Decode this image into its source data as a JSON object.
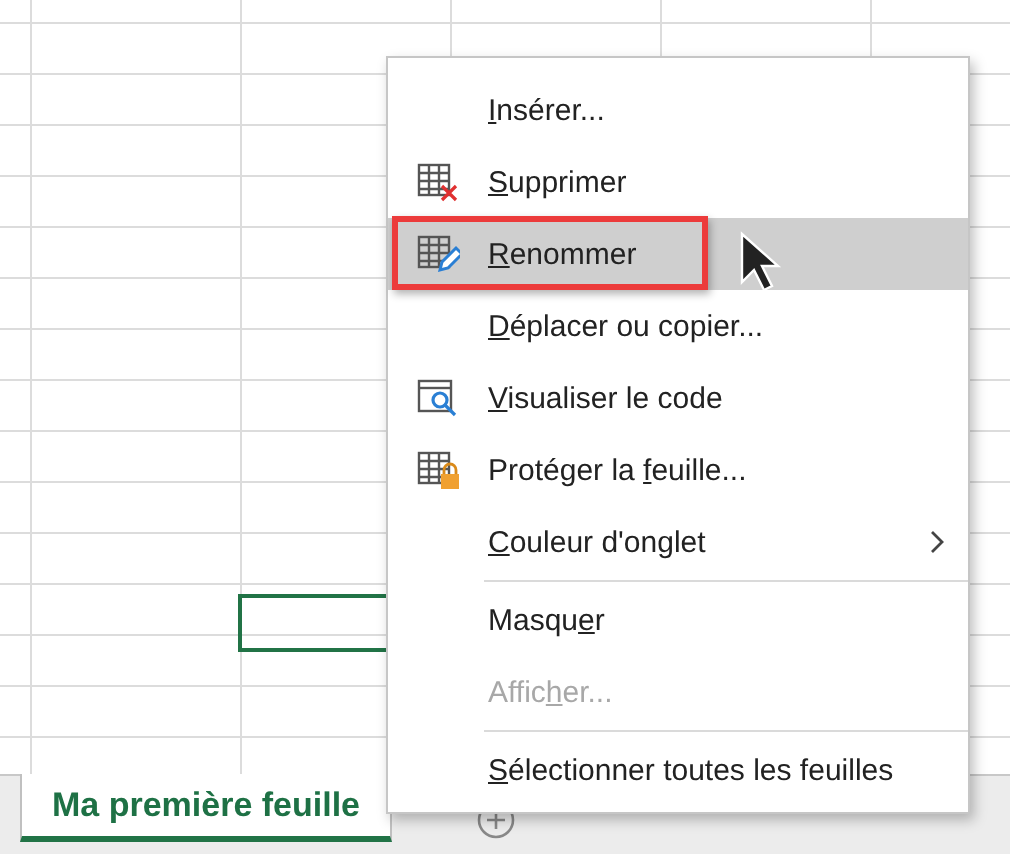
{
  "context_menu": {
    "items": [
      {
        "kind": "plain",
        "key": "I",
        "after": "nsérer...",
        "disabled": false,
        "selected": false,
        "annotated": false
      },
      {
        "kind": "delete",
        "key": "S",
        "after": "upprimer",
        "disabled": false,
        "selected": false,
        "annotated": false
      },
      {
        "kind": "rename",
        "key": "R",
        "after": "enommer",
        "disabled": false,
        "selected": true,
        "annotated": true
      },
      {
        "kind": "plain",
        "key": "D",
        "after": "éplacer ou copier...",
        "disabled": false,
        "selected": false,
        "annotated": false
      },
      {
        "kind": "view",
        "key": "V",
        "after": "isualiser le code",
        "disabled": false,
        "selected": false,
        "annotated": false
      },
      {
        "kind": "protect",
        "before": "Protéger la ",
        "key": "f",
        "after": "euille...",
        "disabled": false,
        "selected": false,
        "annotated": false
      },
      {
        "kind": "submenu",
        "key": "C",
        "after": "ouleur d'onglet",
        "disabled": false,
        "selected": false,
        "annotated": false
      },
      {
        "kind": "separator"
      },
      {
        "kind": "plain",
        "before": "Masqu",
        "key": "e",
        "after": "r",
        "disabled": false,
        "selected": false,
        "annotated": false
      },
      {
        "kind": "plain",
        "before": "Affic",
        "key": "h",
        "after": "er...",
        "disabled": true,
        "selected": false,
        "annotated": false
      },
      {
        "kind": "separator"
      },
      {
        "kind": "plain",
        "key": "S",
        "after": "électionner toutes les feuilles",
        "disabled": false,
        "selected": false,
        "annotated": false
      }
    ]
  },
  "sheet_tabs": [
    {
      "label": "Ma première feuille",
      "selected": true
    }
  ]
}
